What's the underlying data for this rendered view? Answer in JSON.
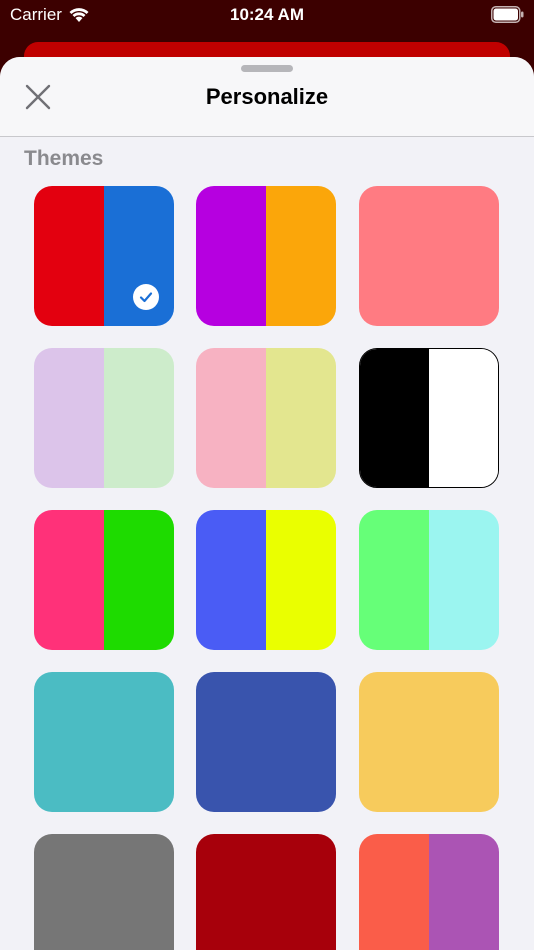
{
  "status_bar": {
    "carrier": "Carrier",
    "time": "10:24 AM"
  },
  "sheet": {
    "title": "Personalize",
    "close_icon": "close-icon"
  },
  "themes": {
    "label": "Themes",
    "items": [
      {
        "colors": [
          "#e3000f",
          "#1a6fd6"
        ],
        "selected": true
      },
      {
        "colors": [
          "#b600e0",
          "#fba60a"
        ],
        "selected": false
      },
      {
        "colors": [
          "#ff7b82"
        ],
        "selected": false
      },
      {
        "colors": [
          "#dcc4ea",
          "#cdeccb"
        ],
        "selected": false
      },
      {
        "colors": [
          "#f7b2c2",
          "#e3e68f"
        ],
        "selected": false
      },
      {
        "colors": [
          "#000000",
          "#ffffff"
        ],
        "selected": false,
        "outlined": true
      },
      {
        "colors": [
          "#ff3179",
          "#1edb00"
        ],
        "selected": false
      },
      {
        "colors": [
          "#4a5cf5",
          "#eaff00"
        ],
        "selected": false
      },
      {
        "colors": [
          "#66ff78",
          "#9bf5f0"
        ],
        "selected": false
      },
      {
        "colors": [
          "#4bbcc3"
        ],
        "selected": false
      },
      {
        "colors": [
          "#3954ad"
        ],
        "selected": false
      },
      {
        "colors": [
          "#f7cb5c"
        ],
        "selected": false
      },
      {
        "colors": [
          "#767676"
        ],
        "selected": false
      },
      {
        "colors": [
          "#a7000b"
        ],
        "selected": false
      },
      {
        "colors": [
          "#fa5d49",
          "#ab54b4"
        ],
        "selected": false
      }
    ]
  }
}
